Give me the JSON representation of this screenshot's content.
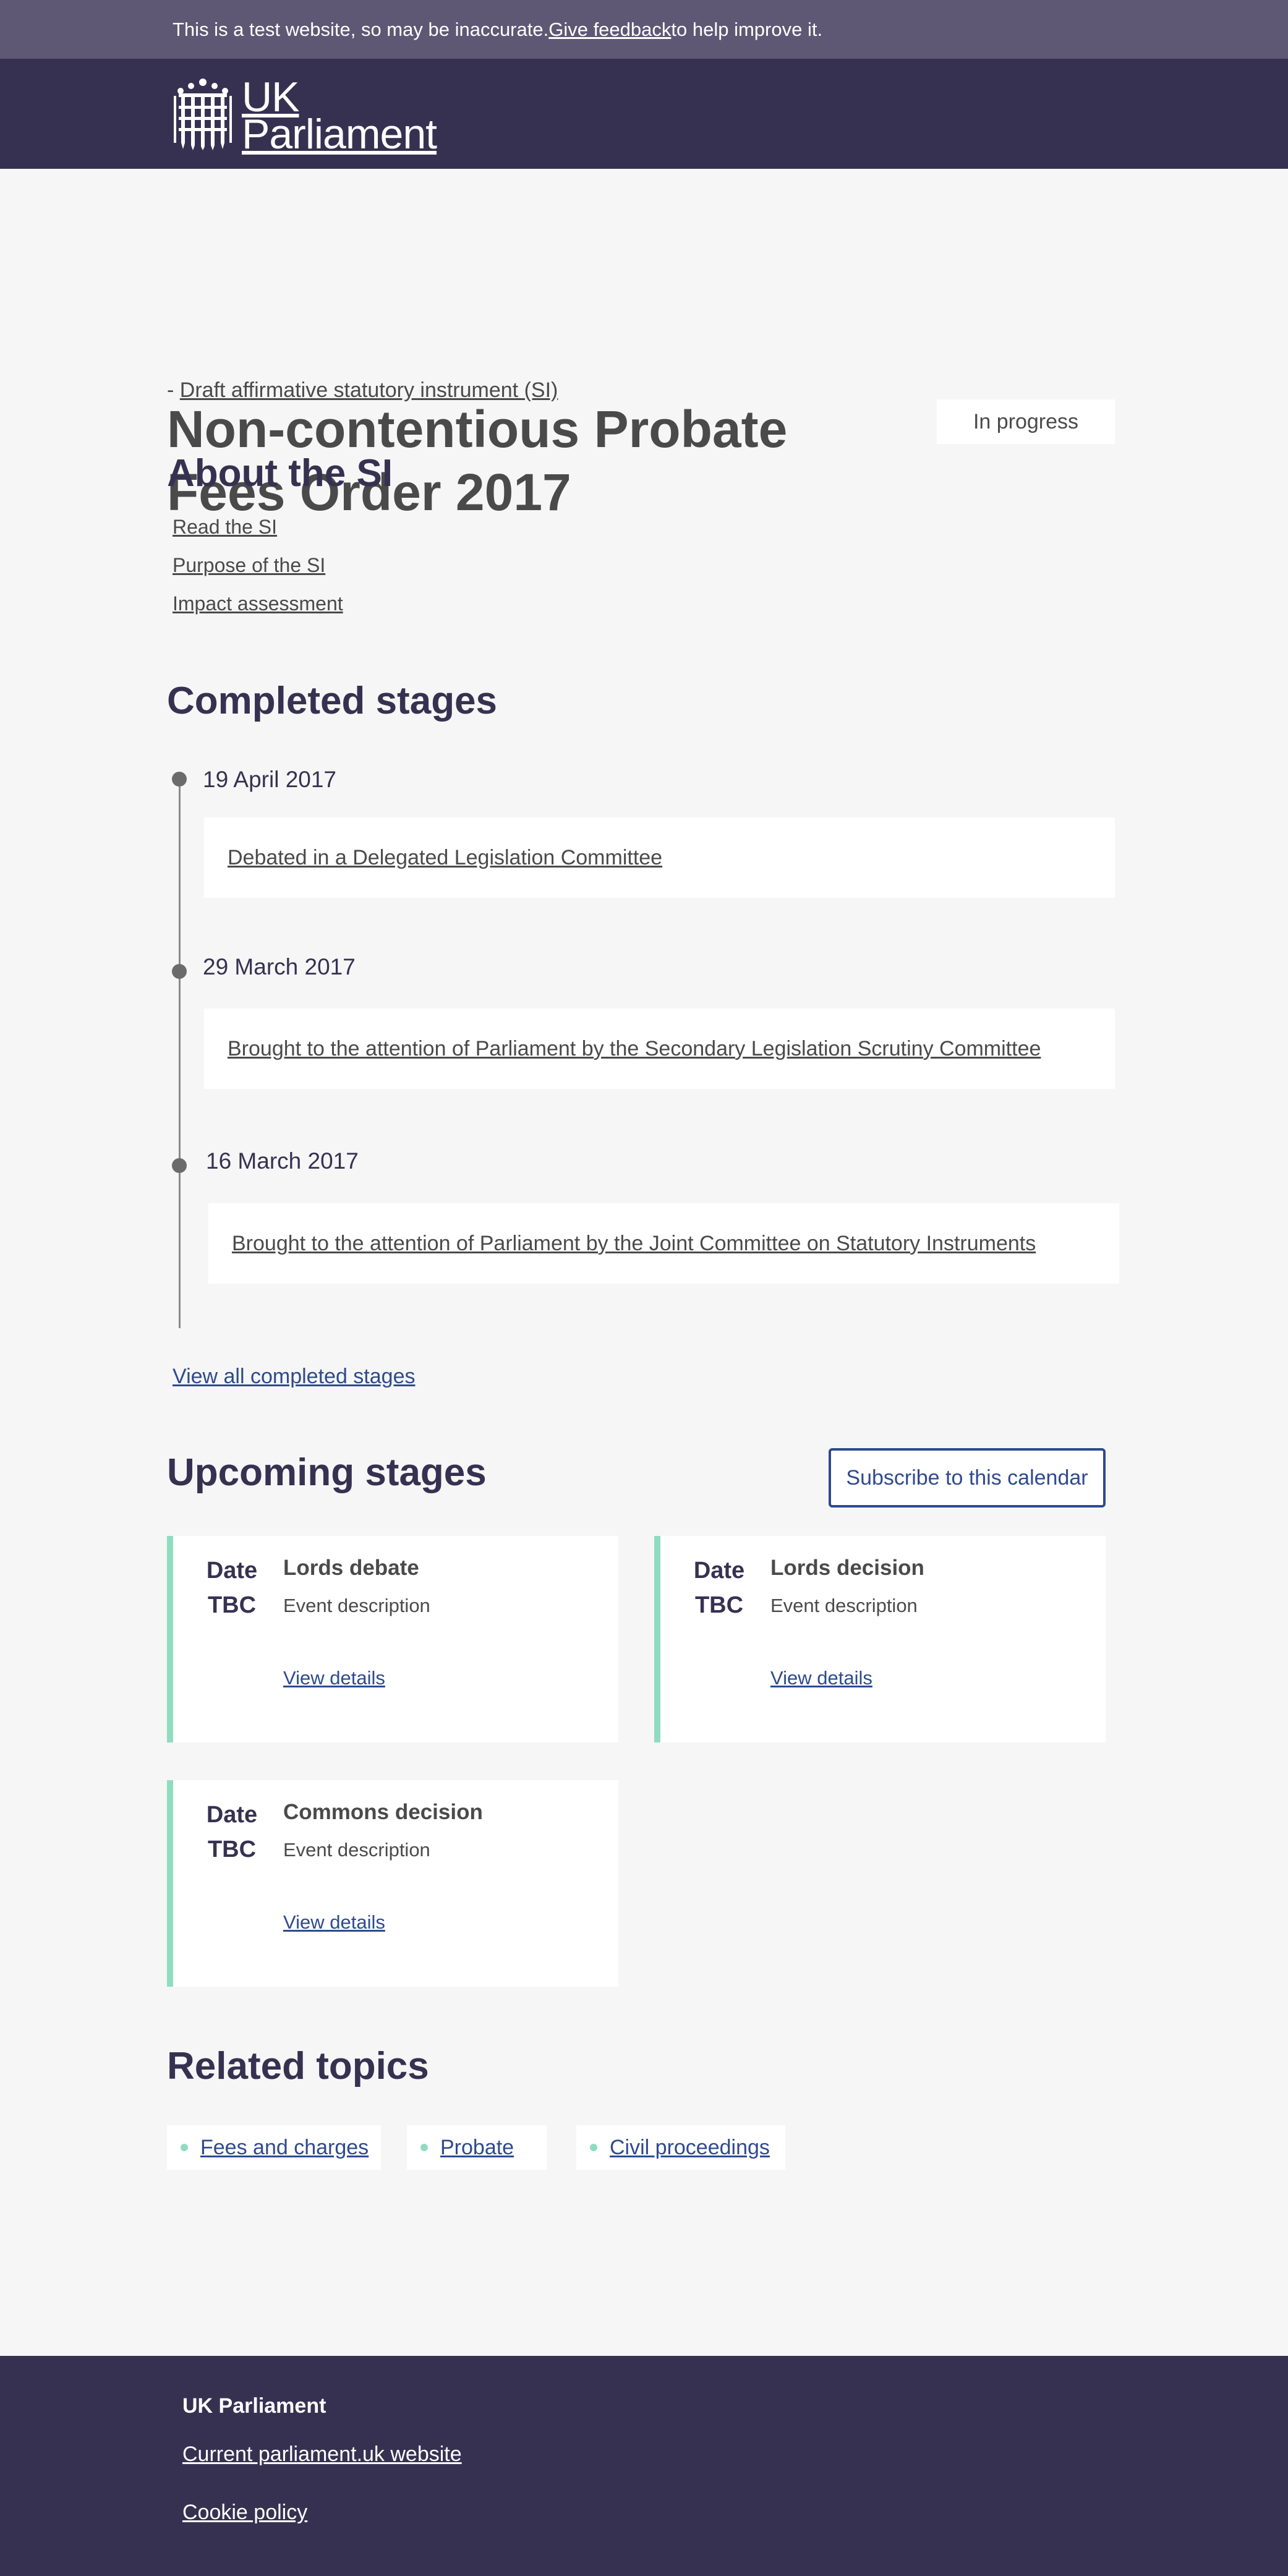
{
  "banner": {
    "text_before": "This is a test website, so may be inaccurate. ",
    "link": "Give feedback",
    "text_after": " to help improve it."
  },
  "header": {
    "logo_line1": "UK",
    "logo_line2": "Parliament",
    "logo_icon": "portcullis-icon"
  },
  "page": {
    "title": "Non-contentious Probate Fees Order 2017",
    "status": "In progress",
    "subtype_prefix": "- ",
    "subtype_link": "Draft affirmative statutory instrument (SI)"
  },
  "about": {
    "title": "About the SI",
    "links": [
      "Read the SI",
      "Purpose of the SI",
      "Impact assessment"
    ]
  },
  "completed": {
    "title": "Completed stages",
    "stages": [
      {
        "date": "19 April 2017",
        "event": "Debated in a Delegated Legislation Committee"
      },
      {
        "date": "29 March 2017",
        "event": "Brought to the attention of Parliament by the Secondary Legislation Scrutiny Committee"
      },
      {
        "date": "16 March 2017",
        "event": "Brought to the attention of Parliament by the Joint Committee on Statutory Instruments"
      }
    ],
    "view_all": "View all completed stages"
  },
  "upcoming": {
    "title": "Upcoming stages",
    "subscribe": "Subscribe to  this calendar",
    "accent_color": "#8fdcc1",
    "events": [
      {
        "date_line1": "Date",
        "date_line2": "TBC",
        "name": "Lords debate",
        "description": "Event description",
        "link": "View details"
      },
      {
        "date_line1": "Date",
        "date_line2": "TBC",
        "name": "Lords decision",
        "description": "Event description",
        "link": "View details"
      },
      {
        "date_line1": "Date",
        "date_line2": "TBC",
        "name": "Commons decision",
        "description": "Event description",
        "link": "View details"
      }
    ]
  },
  "related": {
    "title": "Related topics",
    "topics": [
      "Fees and charges",
      "Probate",
      "Civil proceedings"
    ]
  },
  "footer": {
    "title": "UK Parliament",
    "links": [
      "Current parliament.uk website",
      "Cookie policy"
    ]
  },
  "colors": {
    "header_bg": "#373151",
    "banner_bg": "#5f5874",
    "link_blue": "#2e4a8f",
    "page_bg": "#f6f6f6"
  }
}
